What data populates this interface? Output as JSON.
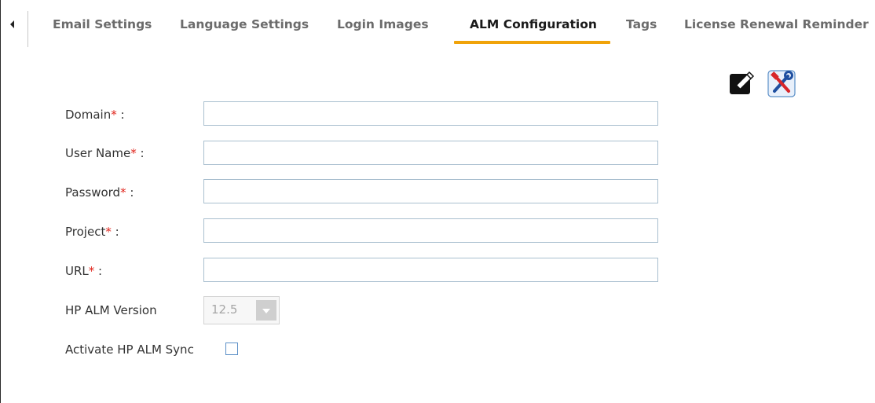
{
  "tabs": [
    {
      "label": "Email Settings",
      "active": false
    },
    {
      "label": "Language Settings",
      "active": false
    },
    {
      "label": "Login Images",
      "active": false
    },
    {
      "label": "ALM Configuration",
      "active": true
    },
    {
      "label": "Tags",
      "active": false
    },
    {
      "label": "License Renewal Reminder",
      "active": false
    }
  ],
  "toolbar": {
    "edit_icon": "edit-pencil-icon",
    "test_icon": "tools-icon"
  },
  "form": {
    "domain": {
      "label": "Domain",
      "required_mark": "*",
      "colon": " :",
      "value": ""
    },
    "user_name": {
      "label": "User Name",
      "required_mark": "*",
      "colon": " :",
      "value": ""
    },
    "password": {
      "label": "Password",
      "required_mark": "*",
      "colon": " :",
      "value": ""
    },
    "project": {
      "label": "Project",
      "required_mark": "*",
      "colon": " :",
      "value": ""
    },
    "url": {
      "label": "URL",
      "required_mark": "*",
      "colon": " :",
      "value": ""
    },
    "version": {
      "label": "HP ALM Version",
      "selected": "12.5"
    },
    "sync": {
      "label": "Activate HP ALM Sync",
      "checked": false
    }
  },
  "colors": {
    "active_tab_underline": "#f0a30a",
    "required_asterisk": "#e0241b",
    "input_border": "#a9bfcf"
  }
}
